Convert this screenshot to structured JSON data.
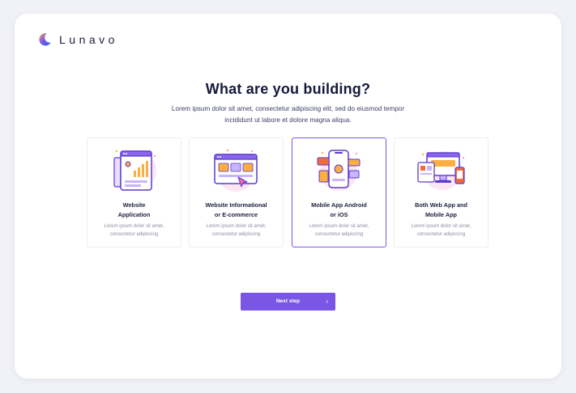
{
  "brand": {
    "name": "Lunavo"
  },
  "heading": "What are you building?",
  "subtitle": "Lorem ipsum dolor sit amet, consectetur adipiscing elit, sed do eiusmod tempor incididunt ut labore et dolore magna aliqua.",
  "options": [
    {
      "title": "Website\nApplication",
      "desc": "Lorem ipsum dolor sit amet, consectetur adipiscing",
      "selected": false
    },
    {
      "title": "Website Informational\nor E-commerce",
      "desc": "Lorem ipsum dolor sit amet, consectetur adipiscing",
      "selected": false
    },
    {
      "title": "Mobile App Android\nor iOS",
      "desc": "Lorem ipsum dolor sit amet, consectetur adipiscing",
      "selected": true
    },
    {
      "title": "Both Web App and\nMobile App",
      "desc": "Lorem ipsum dolor sit amet, consectetur adipiscing",
      "selected": false
    }
  ],
  "next_button": {
    "label": "Next step",
    "icon": "chevron-right-icon"
  },
  "colors": {
    "accent": "#7a56e4",
    "heading": "#16193d",
    "illus_orange": "#fcae42",
    "illus_pink": "#fde6f1"
  }
}
